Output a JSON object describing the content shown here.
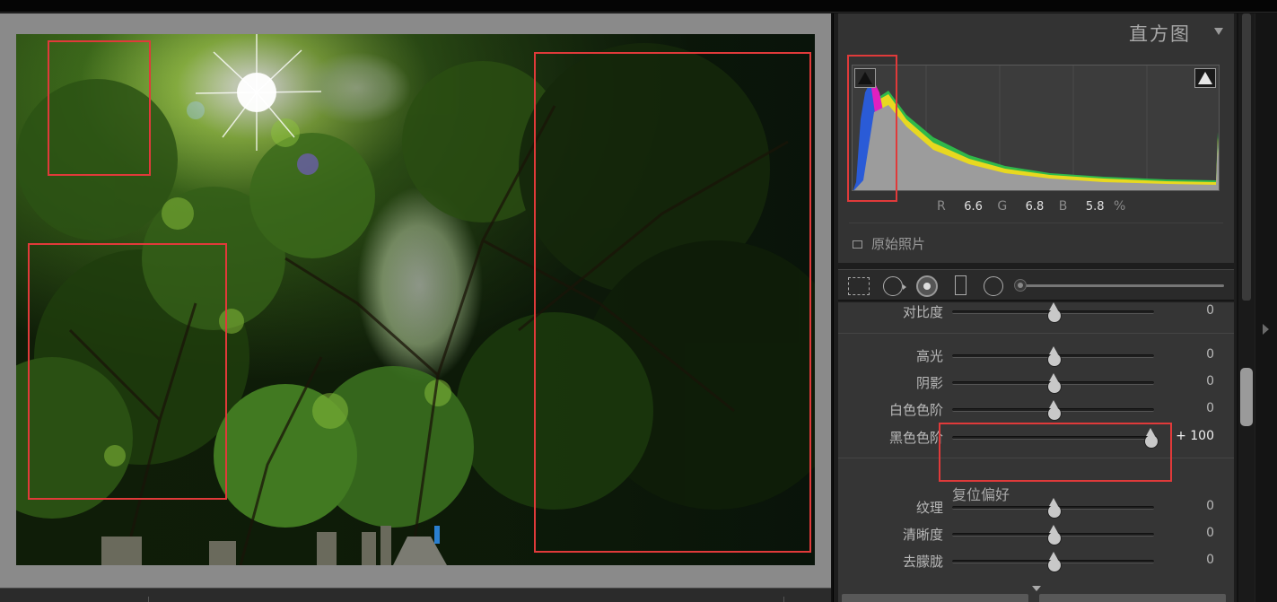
{
  "histogram": {
    "title": "直方图",
    "r_label": "R",
    "r_value": "6.6",
    "g_label": "G",
    "g_value": "6.8",
    "b_label": "B",
    "b_value": "5.8",
    "percent": "%",
    "original_photo_label": "原始照片"
  },
  "adjustments": {
    "rows": [
      {
        "label": "对比度",
        "value": "0",
        "level": 0
      },
      {
        "label": "高光",
        "value": "0",
        "level": 0
      },
      {
        "label": "阴影",
        "value": "0",
        "level": 0
      },
      {
        "label": "白色色阶",
        "value": "0",
        "level": 0
      },
      {
        "label": "黑色色阶",
        "value": "+ 100",
        "level": 100
      },
      {
        "label": "纹理",
        "value": "0",
        "level": 0
      },
      {
        "label": "清晰度",
        "value": "0",
        "level": 0
      },
      {
        "label": "去朦胧",
        "value": "0",
        "level": 0
      }
    ],
    "reset_label": "复位偏好"
  },
  "colors": {
    "annotation_red": "#e03a3a",
    "panel_bg": "#353535",
    "histogram_blue": "#2a5bd7",
    "histogram_magenta": "#e020c0",
    "histogram_yellow": "#e8d820",
    "histogram_green": "#2fb84a"
  },
  "icons": [
    "crop-icon",
    "spot-removal-icon",
    "red-eye-icon",
    "graduated-filter-icon",
    "radial-filter-icon",
    "adjustment-brush-icon",
    "histogram-menu-arrow-icon",
    "shadow-clipping-icon",
    "highlight-clipping-icon"
  ]
}
